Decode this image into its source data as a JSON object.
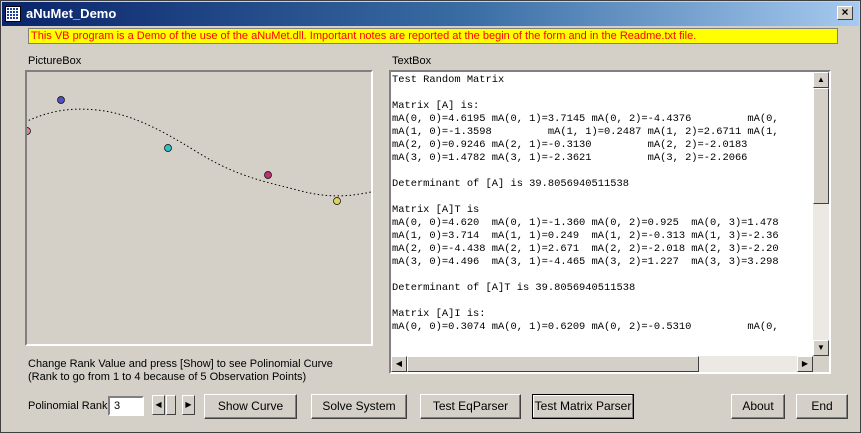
{
  "window": {
    "title": "aNuMet_Demo",
    "close_glyph": "×"
  },
  "notice": "This VB program is a Demo of the use of the aNuMet.dll. Important notes are reported at the begin of the form and in the Readme.txt file.",
  "picturebox": {
    "label": "PictureBox",
    "point_colors": [
      "#e080a0",
      "#5050c0",
      "#30c0c0",
      "#c03070",
      "#e0d060"
    ]
  },
  "textbox": {
    "label": "TextBox",
    "lines": [
      "Test Random Matrix",
      "",
      "Matrix [A] is:",
      "mA(0, 0)=4.6195 mA(0, 1)=3.7145 mA(0, 2)=-4.4376         mA(0,",
      "mA(1, 0)=-1.3598         mA(1, 1)=0.2487 mA(1, 2)=2.6711 mA(1,",
      "mA(2, 0)=0.9246 mA(2, 1)=-0.3130         mA(2, 2)=-2.0183",
      "mA(3, 0)=1.4782 mA(3, 1)=-2.3621         mA(3, 2)=-2.2066",
      "",
      "Determinant of [A] is 39.8056940511538",
      "",
      "Matrix [A]T is",
      "mA(0, 0)=4.620  mA(0, 1)=-1.360 mA(0, 2)=0.925  mA(0, 3)=1.478",
      "mA(1, 0)=3.714  mA(1, 1)=0.249  mA(1, 2)=-0.313 mA(1, 3)=-2.36",
      "mA(2, 0)=-4.438 mA(2, 1)=2.671  mA(2, 2)=-2.018 mA(2, 3)=-2.20",
      "mA(3, 0)=4.496  mA(3, 1)=-4.465 mA(3, 2)=1.227  mA(3, 3)=3.298",
      "",
      "Determinant of [A]T is 39.8056940511538",
      "",
      "Matrix [A]I is:",
      "mA(0, 0)=0.3074 mA(0, 1)=0.6209 mA(0, 2)=-0.5310         mA(0,"
    ]
  },
  "hint": {
    "line1": "Change Rank Value and press [Show] to see Polinomial Curve",
    "line2": "(Rank to go from 1 to 4 because of 5 Observation Points)"
  },
  "rank": {
    "label": "Polinomial Rank",
    "value": "3"
  },
  "buttons": {
    "show_curve": "Show Curve",
    "solve_system": "Solve System",
    "test_eqparser": "Test EqParser",
    "test_matrix_parser": "Test Matrix Parser",
    "about": "About",
    "end": "End"
  }
}
